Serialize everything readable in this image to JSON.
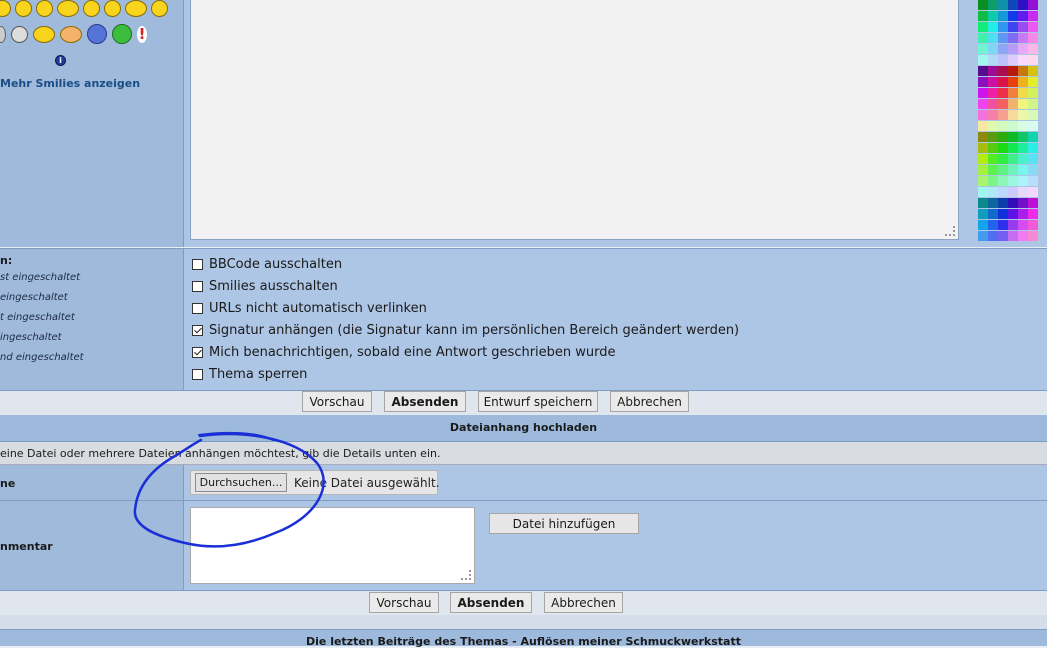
{
  "smilies": {
    "more_label": "Mehr Smilies anzeigen"
  },
  "options": {
    "heading": "n:",
    "status": [
      "st eingeschaltet",
      "eingeschaltet",
      "t eingeschaltet",
      "ingeschaltet",
      "nd eingeschaltet"
    ],
    "checkboxes": [
      {
        "label": "BBCode ausschalten",
        "checked": false
      },
      {
        "label": "Smilies ausschalten",
        "checked": false
      },
      {
        "label": "URLs nicht automatisch verlinken",
        "checked": false
      },
      {
        "label": "Signatur anhängen (die Signatur kann im persönlichen Bereich geändert werden)",
        "checked": true
      },
      {
        "label": "Mich benachrichtigen, sobald eine Antwort geschrieben wurde",
        "checked": true
      },
      {
        "label": "Thema sperren",
        "checked": false
      }
    ]
  },
  "post_buttons": {
    "preview": "Vorschau",
    "submit": "Absenden",
    "save_draft": "Entwurf speichern",
    "cancel": "Abbrechen"
  },
  "attachment": {
    "heading": "Dateianhang hochladen",
    "info": "eine Datei oder mehrere Dateien anhängen möchtest, gib die Details unten ein.",
    "file_label": "ne",
    "comment_label": "nmentar",
    "browse_label": "Durchsuchen...",
    "no_file_label": "Keine Datei ausgewählt.",
    "add_file_label": "Datei hinzufügen"
  },
  "bottom_buttons": {
    "preview": "Vorschau",
    "submit": "Absenden",
    "cancel": "Abbrechen"
  },
  "recent_posts": {
    "heading": "Die letzten Beiträge des Themas - Auflösen meiner Schmuckwerkstatt"
  },
  "colors": {
    "panel_dark": "#9fbadb",
    "panel_light": "#aec6e5",
    "link": "#1b4d86",
    "annotation": "#1a2fd6"
  }
}
